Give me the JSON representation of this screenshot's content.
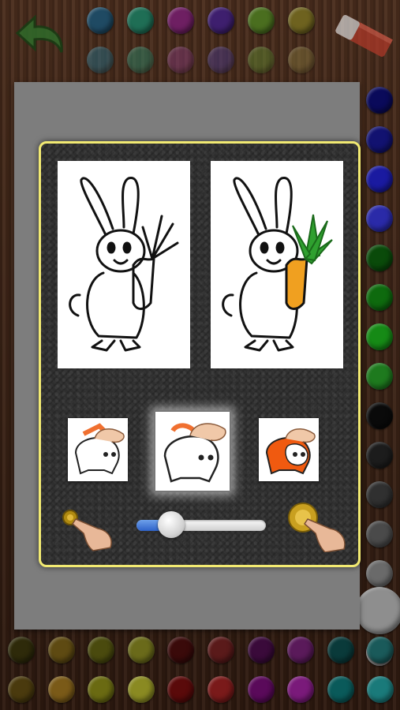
{
  "toolbar": {
    "undo_icon": "undo-arrow-icon",
    "eraser_icon": "eraser-icon"
  },
  "palette": {
    "top_row_1": [
      "#1f4a63",
      "#1f6e55",
      "#6e1f62",
      "#3e1f6e",
      "#4a6e1f",
      "#6e621f"
    ],
    "top_row_2": [
      "#2a6a7e",
      "#2f7e62",
      "#7e3a6e",
      "#4b3a7e",
      "#5e7e2f",
      "#7e6e3a"
    ],
    "right_column": [
      "#0a0a5a",
      "#121270",
      "#1a1aa0",
      "#2a2aa8",
      "#0a4a0a",
      "#0e6a0e",
      "#168a16",
      "#1e7a1e",
      "#0a0a0a",
      "#1c1c1c",
      "#303030",
      "#4a4a4a",
      "#6a6a6a",
      "#8a8a8a",
      "#a0a0a0"
    ],
    "bottom_row_1": [
      "#2e2a0a",
      "#5e4a12",
      "#4a4a0e",
      "#6a6a1a",
      "#3a0a0a",
      "#5a1a1a",
      "#3a0a3a",
      "#5a1a5a",
      "#0a3a3a",
      "#1a5a5a"
    ],
    "bottom_row_2": [
      "#4a3a0e",
      "#7a5a18",
      "#6a6a12",
      "#8a8a22",
      "#5a0a0a",
      "#7a1a1a",
      "#5a0a5a",
      "#7a1a7a",
      "#0a5a5a",
      "#1a7a7a"
    ]
  },
  "help": {
    "example_before": "bunny-outline-uncolored",
    "example_after": "bunny-colored-orange-carrot",
    "modes": [
      {
        "name": "tap-fill-outline-mode",
        "selected": false
      },
      {
        "name": "tap-fill-white-mode",
        "selected": true
      },
      {
        "name": "tap-fill-orange-mode",
        "selected": false
      }
    ],
    "brush_size": 0.26,
    "small_brush_icon": "small-brush-tap-icon",
    "large_brush_icon": "large-brush-tap-icon"
  }
}
